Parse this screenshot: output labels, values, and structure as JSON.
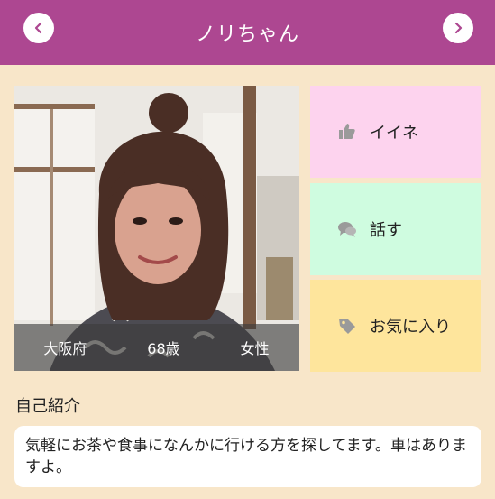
{
  "header": {
    "title": "ノリちゃん"
  },
  "profile": {
    "prefecture": "大阪府",
    "age": "68歳",
    "gender": "女性"
  },
  "actions": {
    "like": "イイネ",
    "talk": "話す",
    "favorite": "お気に入り"
  },
  "intro": {
    "heading": "自己紹介",
    "text": "気軽にお茶や食事になんかに行ける方を探してます。車はありますよ。"
  },
  "colors": {
    "header": "#ad4791",
    "background": "#f8e6c9",
    "like": "#fdd3ee",
    "talk": "#cffce0",
    "favorite": "#fee59c"
  }
}
